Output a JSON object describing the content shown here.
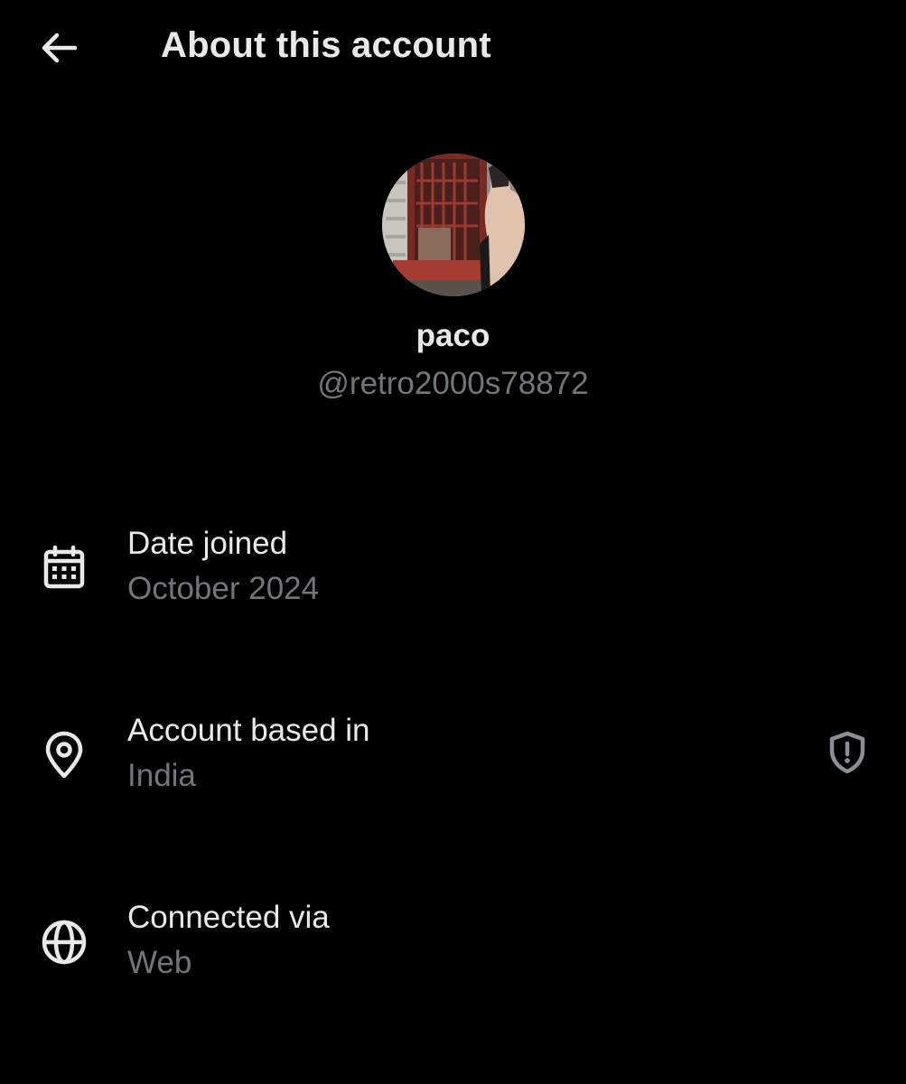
{
  "header": {
    "back_icon": "arrow-left-icon",
    "title": "About this account"
  },
  "profile": {
    "avatar_icon": "profile-photo",
    "display_name": "paco",
    "handle": "@retro2000s78872"
  },
  "rows": [
    {
      "icon": "calendar-icon",
      "label": "Date joined",
      "value": "October 2024"
    },
    {
      "icon": "location-pin-icon",
      "label": "Account based in",
      "value": "India",
      "trailing_icon": "shield-alert-icon"
    },
    {
      "icon": "globe-icon",
      "label": "Connected via",
      "value": "Web"
    }
  ],
  "colors": {
    "background": "#000000",
    "primary_text": "#e7e9ea",
    "secondary_text": "#71767b"
  }
}
